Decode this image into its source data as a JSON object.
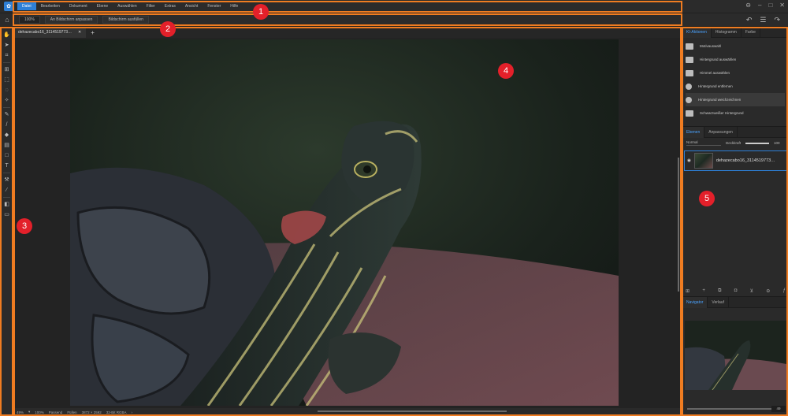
{
  "menu": {
    "items": [
      "Datei",
      "Bearbeiten",
      "Dokument",
      "Ebene",
      "Auswählen",
      "Filter",
      "Extras",
      "Ansicht",
      "Fenster",
      "Hilfe"
    ],
    "active": 0
  },
  "toolbar": {
    "zoom": "100%",
    "fit_label": "An Bildschirm anpassen",
    "fill_label": "Bildschirm ausfüllen"
  },
  "document": {
    "tab_title": "dehazecabo16_3114519773…"
  },
  "statusbar": {
    "zoom": "49%",
    "scale": "100%",
    "mode1": "Passend",
    "mode2": "Füllen",
    "dimensions": "3872 × 2592",
    "colormode": "32-Bit RGBA"
  },
  "right_panel": {
    "tabs": [
      "KI-Aktionen",
      "Histogramm",
      "Farbe"
    ],
    "ai_actions": [
      "Motivauswahl",
      "Hintergrund auswählen",
      "Himmel auswählen",
      "Hintergrund entfernen",
      "Hintergrund weichzeichnen",
      "Schwarzweißer Hintergrund"
    ],
    "ai_active": 4,
    "layer_tabs": [
      "Ebenen",
      "Anpassungen"
    ],
    "blend_mode": "Normal",
    "opacity_label": "Deckkraft",
    "opacity_value": "100",
    "layer_name": "dehazecabo16_3114519773…",
    "nav_tabs": [
      "Navigator",
      "Verlauf"
    ],
    "nav_zoom": "49"
  },
  "markers": [
    "1",
    "2",
    "3",
    "4",
    "5"
  ],
  "colors": {
    "accent": "#2d7fd6",
    "marker": "#e3202a",
    "outline": "#ef7c21"
  }
}
